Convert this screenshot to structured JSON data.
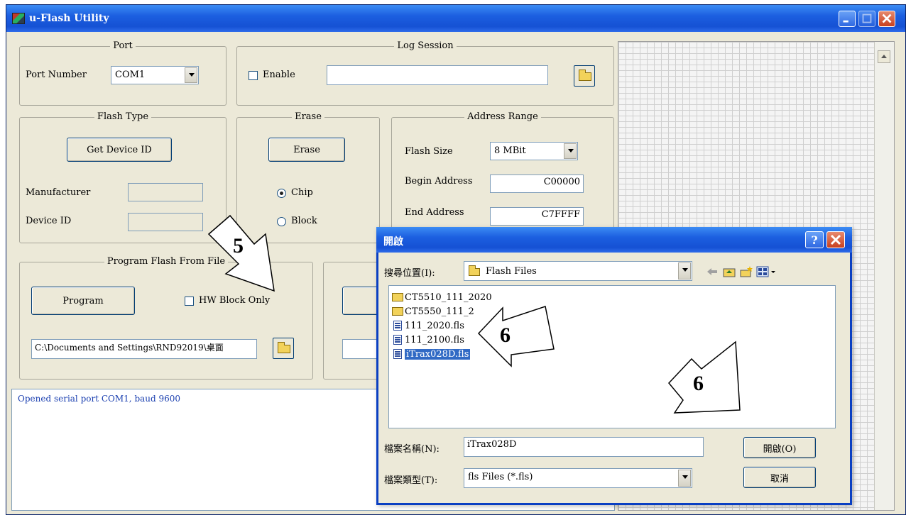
{
  "main_window": {
    "title": "u-Flash Utility",
    "port": {
      "group_title": "Port",
      "port_number_label": "Port Number",
      "port_value": "COM1"
    },
    "log_session": {
      "group_title": "Log Session",
      "enable_label": "Enable",
      "path_value": ""
    },
    "flash_type": {
      "group_title": "Flash Type",
      "get_device_id_label": "Get Device ID",
      "manufacturer_label": "Manufacturer",
      "device_id_label": "Device ID"
    },
    "erase": {
      "group_title": "Erase",
      "erase_button_label": "Erase",
      "chip_label": "Chip",
      "block_label": "Block",
      "selected": "Chip"
    },
    "address_range": {
      "group_title": "Address Range",
      "flash_size_label": "Flash Size",
      "flash_size_value": "8 MBit",
      "begin_address_label": "Begin Address",
      "begin_address_value": "C00000",
      "end_address_label": "End Address",
      "end_address_value": "C7FFFF"
    },
    "program_from_file": {
      "group_title": "Program Flash From File",
      "program_button_label": "Program",
      "hw_block_only_label": "HW Block Only",
      "file_path_value": "C:\\Documents and Settings\\RND92019\\桌面"
    },
    "log_text": "Opened serial port COM1, baud 9600"
  },
  "open_dialog": {
    "title": "開啟",
    "look_in_label": "搜尋位置(I):",
    "look_in_value": "Flash Files",
    "files": [
      {
        "name": "CT5510_111_2020",
        "kind": "folder"
      },
      {
        "name": "CT5550_111_2",
        "kind": "folder"
      },
      {
        "name": "111_2020.fls",
        "kind": "file"
      },
      {
        "name": "111_2100.fls",
        "kind": "file"
      },
      {
        "name": "iTrax028D.fls",
        "kind": "file",
        "selected": true
      }
    ],
    "file_name_label": "檔案名稱(N):",
    "file_name_value": "iTrax028D",
    "file_type_label": "檔案類型(T):",
    "file_type_value": "fls Files (*.fls)",
    "open_button_label": "開啟(O)",
    "cancel_button_label": "取消",
    "help_glyph": "?"
  },
  "annotations": {
    "step5": "5",
    "step6a": "6",
    "step6b": "6"
  },
  "icons": {
    "title_icon": "app-icon",
    "folder": "folder-icon",
    "back": "back-arrow-icon",
    "up": "up-folder-icon",
    "new_folder": "new-folder-icon",
    "view": "view-menu-icon"
  }
}
